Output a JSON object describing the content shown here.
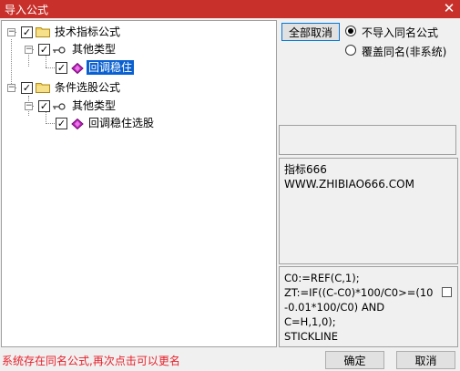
{
  "window": {
    "title": "导入公式",
    "close_glyph": "✕"
  },
  "tree": {
    "nodes": [
      {
        "label": "技术指标公式",
        "checked": true,
        "expander": "−",
        "icon": "folder-icon"
      },
      {
        "label": "其他类型",
        "checked": true,
        "expander": "−",
        "icon": "key-icon"
      },
      {
        "label": "回调稳住",
        "checked": true,
        "selected": true,
        "icon": "gem-icon"
      },
      {
        "label": "条件选股公式",
        "checked": true,
        "expander": "−",
        "icon": "folder-icon"
      },
      {
        "label": "其他类型",
        "checked": true,
        "expander": "−",
        "icon": "key-icon"
      },
      {
        "label": "回调稳住选股",
        "checked": true,
        "icon": "gem-icon"
      }
    ],
    "check_glyph": "✓"
  },
  "options": {
    "deselect_all_label": "全部取消",
    "radio_skip_label": "不导入同名公式",
    "radio_overwrite_label": "覆盖同名(非系统)",
    "selected": "skip"
  },
  "description": {
    "line1": "指标666",
    "line2": "WWW.ZHIBIAO666.COM"
  },
  "formula": {
    "line1": "C0:=REF(C,1);",
    "line2": "ZT:=IF((C-C0)*100/C0>=(10",
    "line3": "-0.01*100/C0) AND C=H,1,0);",
    "line4": "STICKLINE"
  },
  "status_text": "系统存在同名公式,再次点击可以更名",
  "buttons": {
    "ok_label": "确定",
    "cancel_label": "取消"
  },
  "colors": {
    "titlebar": "#c8312b",
    "selection": "#0a60d0",
    "status": "#e8202a"
  }
}
